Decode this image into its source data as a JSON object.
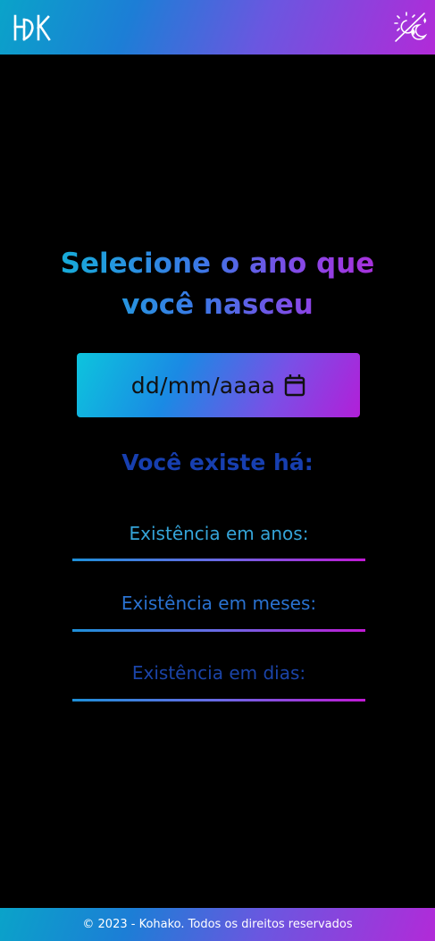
{
  "header": {
    "logo_text": "HK",
    "theme_toggle_icon": "sun-moon-icon"
  },
  "main": {
    "title": "Selecione o ano que você nasceu",
    "date_input": {
      "placeholder": "dd/mm/aaaa",
      "icon": "calendar-icon"
    },
    "exist_heading": "Você existe há:",
    "results": [
      {
        "label": "Existência em anos:",
        "color": "#35a4d8"
      },
      {
        "label": "Existência em meses:",
        "color": "#2a72d0"
      },
      {
        "label": "Existência em dias:",
        "color": "#1b44a8"
      }
    ]
  },
  "footer": {
    "text": "© 2023 - Kohako. Todos os direitos reservados"
  },
  "colors": {
    "background": "#000000",
    "gradient_start": "#0aa3c9",
    "gradient_mid": "#6a57e0",
    "gradient_end": "#b22ad8",
    "exist_heading": "#173fb0"
  }
}
